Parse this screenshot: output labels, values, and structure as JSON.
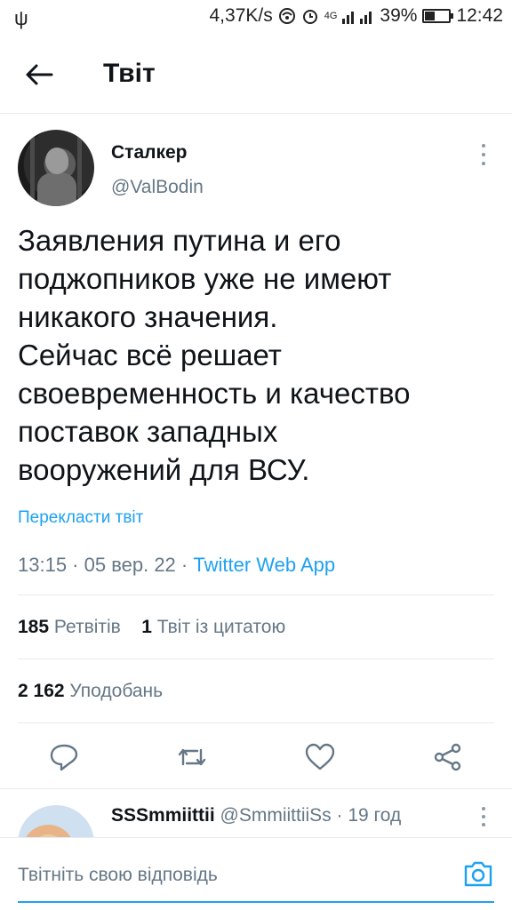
{
  "status_bar": {
    "usb_icon": "ψ",
    "net_speed": "4,37K/s",
    "network_type": "4G",
    "battery_percent": "39%",
    "battery_level": 0.39,
    "time": "12:42"
  },
  "header": {
    "title": "Твіт"
  },
  "tweet": {
    "author_name": "Сталкер",
    "author_handle": "@ValBodin",
    "text": "Заявления путина и его\nподжопников уже не имеют\nникакого значения.\nСейчас всё решает\nсвоевременность и качество\nпоставок западных\nвооружений для ВСУ.",
    "translate_link": "Перекласти твіт",
    "timestamp": "13:15 · 05 вер. 22 · ",
    "source_app": "Twitter Web App",
    "retweets_count": "185",
    "retweets_label": "Ретвітів",
    "quotes_count": "1",
    "quotes_label": "Твіт із цитатою",
    "likes_count": "2 162",
    "likes_label": "Уподобань"
  },
  "reply": {
    "name": "SSSmmiittii",
    "meta": " @SmmiittiiSs · 19 год"
  },
  "compose": {
    "placeholder": "Твітніть свою відповідь"
  },
  "colors": {
    "accent": "#1da1f2",
    "secondary_text": "#657786",
    "primary_text": "#0f1419",
    "divider": "#e6ecf0"
  },
  "icons": [
    "usb-icon",
    "wifi-icon",
    "alarm-icon",
    "signal-icon",
    "battery-icon",
    "back-arrow-icon",
    "more-vertical-icon",
    "reply-icon",
    "retweet-icon",
    "like-icon",
    "share-icon",
    "camera-icon"
  ]
}
